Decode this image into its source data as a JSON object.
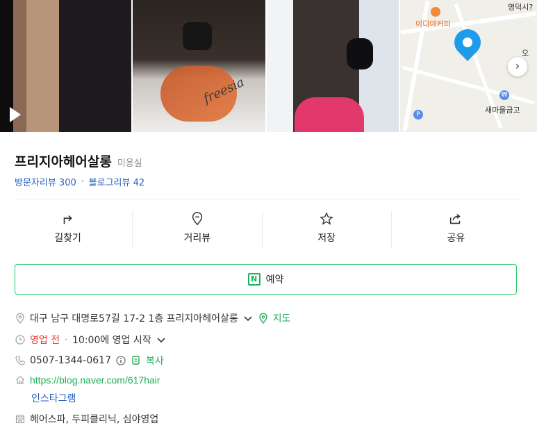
{
  "photos": {
    "map_labels": {
      "top_right": "명덕시?",
      "cafe": "이디야커피",
      "right_edge": "오",
      "bank": "새마을금고"
    },
    "photo2_text": "freesia"
  },
  "place": {
    "name": "프리지아헤어살롱",
    "category": "미용실",
    "visitor_reviews": "방문자리뷰 300",
    "blog_reviews": "블로그리뷰 42"
  },
  "actions": [
    {
      "label": "길찾기",
      "icon": "directions-icon"
    },
    {
      "label": "거리뷰",
      "icon": "street-view-icon"
    },
    {
      "label": "저장",
      "icon": "star-icon"
    },
    {
      "label": "공유",
      "icon": "share-icon"
    }
  ],
  "reserve": {
    "label": "예약",
    "icon_letter": "N"
  },
  "info": {
    "address": "대구 남구 대명로57길 17-2 1층 프리지아헤어살롱",
    "map_link": "지도",
    "status": "영업 전",
    "open_time": "10:00에 영업 시작",
    "phone": "0507-1344-0617",
    "copy_label": "복사",
    "homepage": "https://blog.naver.com/617hair",
    "instagram": "인스타그램",
    "services": "헤어스파, 두피클리닉, 심야영업"
  },
  "colors": {
    "accent_green": "#1fae56",
    "link_blue": "#245ec1",
    "status_red": "#ea3b3b",
    "pin_blue": "#1e9bea"
  }
}
